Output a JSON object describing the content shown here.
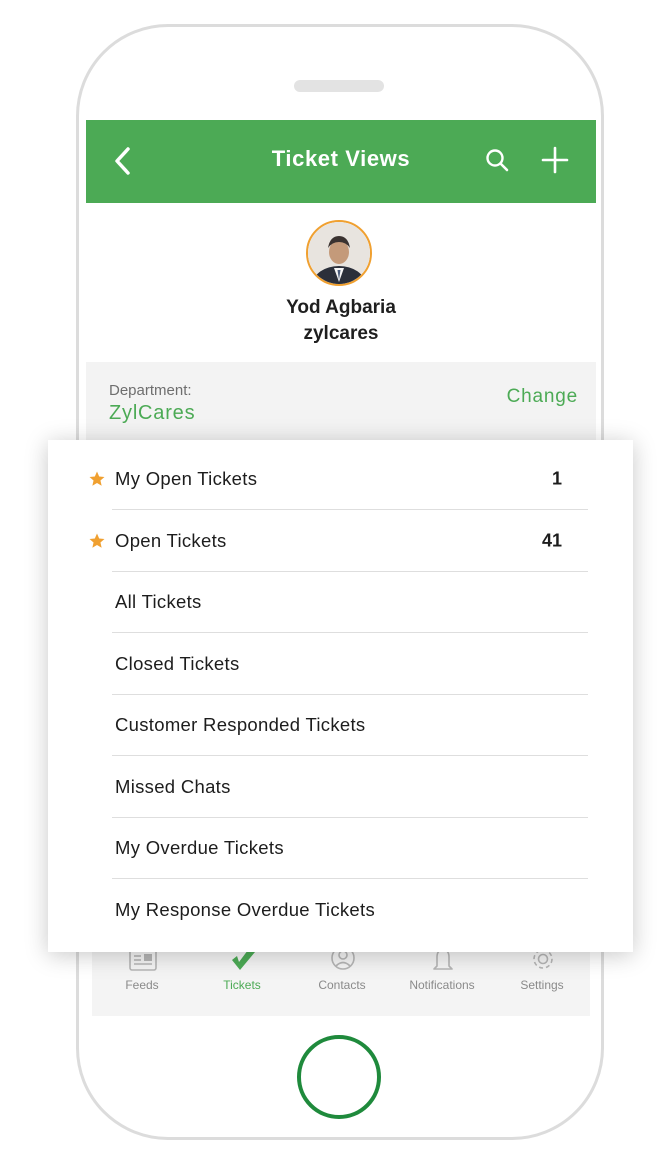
{
  "header": {
    "title": "Ticket Views",
    "back_icon": "chevron-left-icon",
    "search_icon": "search-icon",
    "add_icon": "plus-icon",
    "bar_color": "#4caa55"
  },
  "profile": {
    "name": "Yod Agbaria",
    "org": "zylcares",
    "avatar_ring_color": "#f0a030"
  },
  "department": {
    "label": "Department:",
    "value": "ZylCares",
    "change_label": "Change",
    "accent_color": "#4caa55"
  },
  "views": [
    {
      "label": "My Open Tickets",
      "count": "1",
      "starred": true
    },
    {
      "label": "Open Tickets",
      "count": "41",
      "starred": true
    },
    {
      "label": "All Tickets",
      "count": "",
      "starred": false
    },
    {
      "label": "Closed Tickets",
      "count": "",
      "starred": false
    },
    {
      "label": "Customer Responded Tickets",
      "count": "",
      "starred": false
    },
    {
      "label": "Missed Chats",
      "count": "",
      "starred": false
    },
    {
      "label": "My Overdue Tickets",
      "count": "",
      "starred": false
    },
    {
      "label": "My Response Overdue Tickets",
      "count": "",
      "starred": false
    }
  ],
  "star_color": "#f0a030",
  "tabs": [
    {
      "label": "Feeds",
      "icon": "feeds-icon",
      "active": false
    },
    {
      "label": "Tickets",
      "icon": "tickets-icon",
      "active": true
    },
    {
      "label": "Contacts",
      "icon": "contacts-icon",
      "active": false
    },
    {
      "label": "Notifications",
      "icon": "bell-icon",
      "active": false
    },
    {
      "label": "Settings",
      "icon": "gear-icon",
      "active": false
    }
  ]
}
